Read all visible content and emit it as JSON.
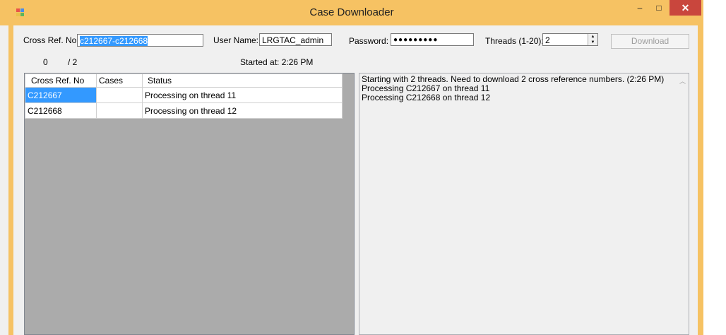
{
  "window": {
    "title": "Case Downloader",
    "minimize_glyph": "–",
    "maximize_glyph": "□",
    "close_glyph": "✕",
    "app_icon": "windows-form-icon"
  },
  "form": {
    "crossref_label": "Cross Ref. No",
    "crossref_value": "c212667-c212668",
    "username_label": "User Name:",
    "username_value": "LRGTAC_admin",
    "password_label": "Password:",
    "password_value": "●●●●●●●●●",
    "threads_label": "Threads (1-20):",
    "threads_value": "2",
    "download_label": "Download"
  },
  "progress": {
    "done": "0",
    "total": "/ 2",
    "started": "Started at: 2:26 PM"
  },
  "grid": {
    "headers": [
      "Cross Ref. No",
      "Cases",
      "Status"
    ],
    "rows": [
      {
        "crossref": "C212667",
        "cases": "",
        "status": "Processing on thread 11",
        "selected": true
      },
      {
        "crossref": "C212668",
        "cases": "",
        "status": "Processing on thread 12",
        "selected": false
      }
    ]
  },
  "log": {
    "lines": [
      "Starting with 2 threads.  Need to download 2 cross reference numbers. (2:26 PM)",
      "Processing C212667 on thread 11",
      "Processing C212668 on thread 12"
    ]
  },
  "colors": {
    "title_bar": "#f6c263",
    "close_button": "#c9463d",
    "selection": "#3399ff",
    "grid_background": "#ababab"
  }
}
